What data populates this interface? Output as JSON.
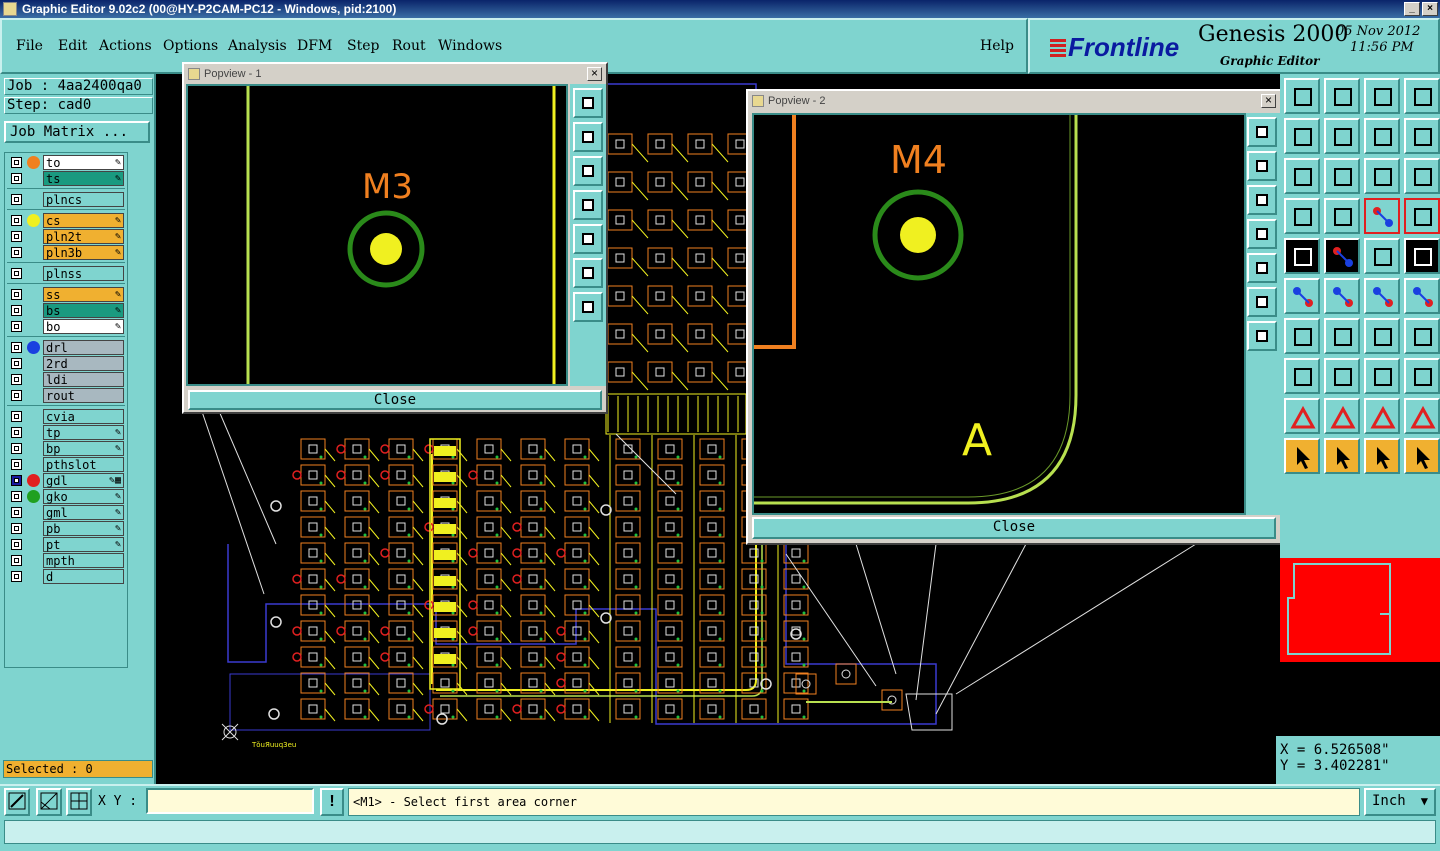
{
  "window": {
    "title": "Graphic Editor 9.02c2 (00@HY-P2CAM-PC12 - Windows, pid:2100)"
  },
  "menu": {
    "items": [
      "File",
      "Edit",
      "Actions",
      "Options",
      "Analysis",
      "DFM",
      "Step",
      "Rout",
      "Windows"
    ],
    "help": "Help"
  },
  "brand": {
    "logo": "Frontline",
    "product": "Genesis 2000",
    "subtitle": "Graphic Editor",
    "date": "05 Nov 2012",
    "time": "11:56 PM"
  },
  "job": {
    "job_label": "Job : 4aa2400qa0",
    "step_label": "Step: cad0",
    "matrix_button": "Job Matrix ..."
  },
  "layers": [
    {
      "name": "to",
      "color": "#ffffff",
      "dot": "#f08020",
      "mark": "pen"
    },
    {
      "name": "ts",
      "color": "#1a9a80",
      "dot": "",
      "mark": "pen"
    },
    {
      "name": "plncs",
      "color": "#7fd4cf",
      "dot": "",
      "mark": ""
    },
    {
      "name": "cs",
      "color": "#f0b030",
      "dot": "#f0f020",
      "mark": "pen"
    },
    {
      "name": "pln2t",
      "color": "#f0b030",
      "dot": "",
      "mark": "pen"
    },
    {
      "name": "pln3b",
      "color": "#f0b030",
      "dot": "",
      "mark": "pen"
    },
    {
      "name": "plnss",
      "color": "#7fd4cf",
      "dot": "",
      "mark": ""
    },
    {
      "name": "ss",
      "color": "#f0b030",
      "dot": "",
      "mark": "pen"
    },
    {
      "name": "bs",
      "color": "#1a9a80",
      "dot": "",
      "mark": "pen"
    },
    {
      "name": "bo",
      "color": "#ffffff",
      "dot": "",
      "mark": "pen"
    },
    {
      "name": "drl",
      "color": "#a8b8c0",
      "dot": "#1a40e0",
      "mark": ""
    },
    {
      "name": "2rd",
      "color": "#a8b8c0",
      "dot": "",
      "mark": ""
    },
    {
      "name": "ldi",
      "color": "#a8b8c0",
      "dot": "",
      "mark": ""
    },
    {
      "name": "rout",
      "color": "#a8b8c0",
      "dot": "",
      "mark": ""
    },
    {
      "name": "cvia",
      "color": "#7fd4cf",
      "dot": "",
      "mark": ""
    },
    {
      "name": "tp",
      "color": "#7fd4cf",
      "dot": "",
      "mark": "pen"
    },
    {
      "name": "bp",
      "color": "#7fd4cf",
      "dot": "",
      "mark": "pen"
    },
    {
      "name": "pthslot",
      "color": "#7fd4cf",
      "dot": "",
      "mark": ""
    },
    {
      "name": "gdl",
      "color": "#7fd4cf",
      "dot": "#e02020",
      "mark": "pen-grid"
    },
    {
      "name": "gko",
      "color": "#7fd4cf",
      "dot": "#20a020",
      "mark": "pen"
    },
    {
      "name": "gml",
      "color": "#7fd4cf",
      "dot": "",
      "mark": "pen"
    },
    {
      "name": "pb",
      "color": "#7fd4cf",
      "dot": "",
      "mark": "pen"
    },
    {
      "name": "pt",
      "color": "#7fd4cf",
      "dot": "",
      "mark": "pen"
    },
    {
      "name": "mpth",
      "color": "#7fd4cf",
      "dot": "",
      "mark": ""
    },
    {
      "name": "d",
      "color": "#7fd4cf",
      "dot": "",
      "mark": ""
    }
  ],
  "selected": "Selected : 0",
  "popview1": {
    "title": "Popview - 1",
    "label": "M3",
    "close": "Close"
  },
  "popview2": {
    "title": "Popview - 2",
    "label": "M4",
    "letter": "A",
    "close": "Close"
  },
  "canvas": {
    "silk_text": "TǒuЯuuq3eu"
  },
  "coords": {
    "x": "X =  6.526508\"",
    "y": "Y =  3.402281\""
  },
  "bottom": {
    "xy_label": "X Y :",
    "xy_value": "",
    "excl": "!",
    "prompt": "<M1> - Select first area corner",
    "unit": "Inch"
  },
  "colors": {
    "panel": "#7fd4cf",
    "trace_yellow": "#f0f020",
    "trace_orange": "#f08020",
    "pad_green": "#1e8a1e",
    "minimap_red": "#ff0000"
  }
}
